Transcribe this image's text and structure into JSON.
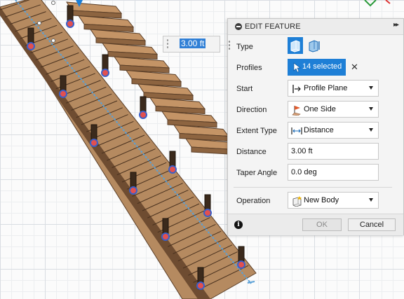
{
  "dimension_input": {
    "value": "3.00 ft"
  },
  "panel": {
    "title": "EDIT FEATURE",
    "expand_glyph": "▸▸",
    "rows": {
      "type": {
        "label": "Type"
      },
      "profiles": {
        "label": "Profiles",
        "selection": "14 selected",
        "clear": "✕"
      },
      "start": {
        "label": "Start",
        "value": "Profile Plane"
      },
      "direction": {
        "label": "Direction",
        "value": "One Side"
      },
      "extent_type": {
        "label": "Extent Type",
        "value": "Distance"
      },
      "distance": {
        "label": "Distance",
        "value": "3.00 ft"
      },
      "taper_angle": {
        "label": "Taper Angle",
        "value": "0.0 deg"
      },
      "operation": {
        "label": "Operation",
        "value": "New Body"
      }
    },
    "info_glyph": "i",
    "ok_label": "OK",
    "cancel_label": "Cancel"
  },
  "icons": {
    "header": "collapse-icon",
    "type_solid": "extrude-solid-icon",
    "type_thin": "extrude-thin-icon",
    "profiles": "cursor-select-icon",
    "start": "profile-plane-icon",
    "direction": "one-side-flag-icon",
    "extent": "distance-icon",
    "operation": "new-body-icon",
    "info": "info-icon"
  },
  "colors": {
    "accent": "#1e7fd6",
    "wood": "#b58a60",
    "wood_dark": "#5b3f28",
    "grid": "#d9dde2",
    "selected_edge": "#5aa0d6"
  }
}
